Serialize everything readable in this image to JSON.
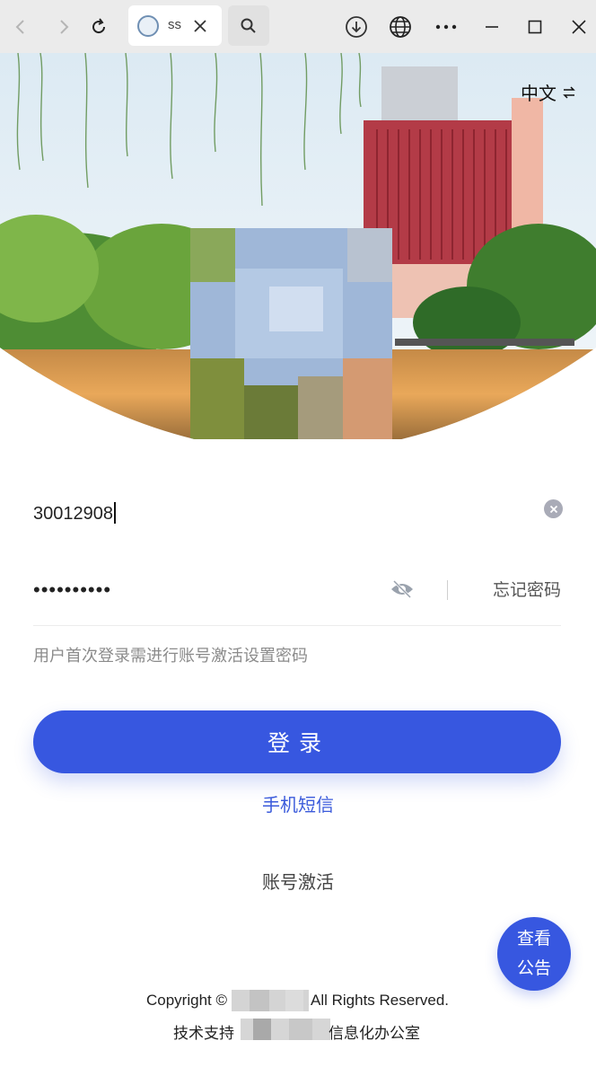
{
  "browser": {
    "tab_title": "ss",
    "icons": [
      "back-icon",
      "forward-icon",
      "reload-icon",
      "close-tab-icon",
      "search-icon",
      "download-icon",
      "globe-icon",
      "more-icon",
      "minimize-icon",
      "maximize-icon",
      "close-icon"
    ]
  },
  "header": {
    "language_label": "中文",
    "language_switch_icon": "swap-icon"
  },
  "login": {
    "account_value": "30012908",
    "password_value": "••••••••••",
    "forgot_label": "忘记密码",
    "hint_text": "用户首次登录需进行账号激活设置密码",
    "login_label": "登录",
    "sms_label": "手机短信",
    "activate_label": "账号激活"
  },
  "notice": {
    "line1": "查看",
    "line2": "公告"
  },
  "footer": {
    "copyright_prefix": "Copyright ©",
    "copyright_suffix": "All Rights Reserved.",
    "support_prefix": "技术支持",
    "support_suffix": "信息化办公室"
  },
  "colors": {
    "primary": "#3757e0",
    "link": "#3b5bdb",
    "browser_bar": "#ebebeb"
  }
}
